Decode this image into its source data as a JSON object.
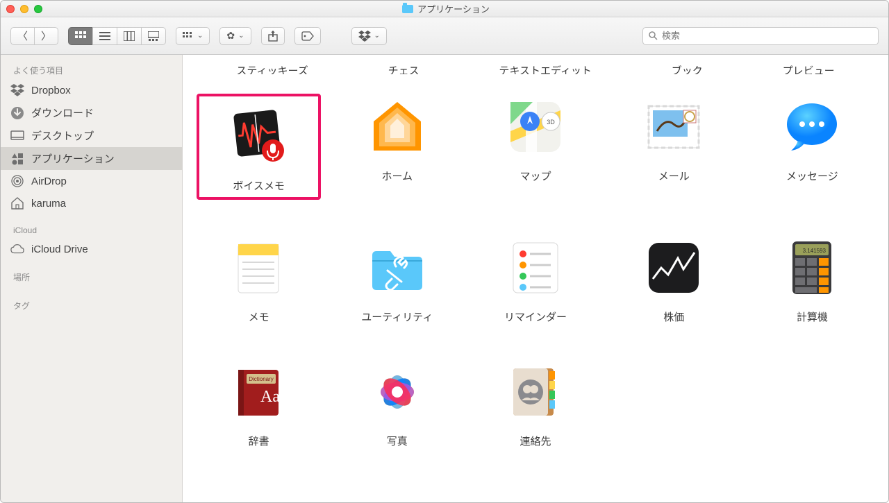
{
  "window": {
    "title": "アプリケーション"
  },
  "toolbar": {
    "search_placeholder": "検索"
  },
  "sidebar": {
    "sections": [
      {
        "header": "よく使う項目",
        "items": [
          {
            "icon": "dropbox",
            "label": "Dropbox"
          },
          {
            "icon": "download",
            "label": "ダウンロード"
          },
          {
            "icon": "desktop",
            "label": "デスクトップ"
          },
          {
            "icon": "apps",
            "label": "アプリケーション",
            "selected": true
          },
          {
            "icon": "airdrop",
            "label": "AirDrop"
          },
          {
            "icon": "home",
            "label": "karuma"
          }
        ]
      },
      {
        "header": "iCloud",
        "items": [
          {
            "icon": "cloud",
            "label": "iCloud Drive"
          }
        ]
      },
      {
        "header": "場所",
        "items": []
      },
      {
        "header": "タグ",
        "items": []
      }
    ]
  },
  "content": {
    "truncated_row": [
      "スティッキーズ",
      "チェス",
      "テキストエディット",
      "ブック",
      "プレビュー"
    ],
    "apps": [
      {
        "id": "voice-memos",
        "label": "ボイスメモ",
        "highlighted": true
      },
      {
        "id": "home",
        "label": "ホーム"
      },
      {
        "id": "maps",
        "label": "マップ"
      },
      {
        "id": "mail",
        "label": "メール"
      },
      {
        "id": "messages",
        "label": "メッセージ"
      },
      {
        "id": "notes",
        "label": "メモ"
      },
      {
        "id": "utilities",
        "label": "ユーティリティ"
      },
      {
        "id": "reminders",
        "label": "リマインダー"
      },
      {
        "id": "stocks",
        "label": "株価"
      },
      {
        "id": "calculator",
        "label": "計算機"
      },
      {
        "id": "dictionary",
        "label": "辞書"
      },
      {
        "id": "photos",
        "label": "写真"
      },
      {
        "id": "contacts",
        "label": "連絡先"
      }
    ]
  }
}
